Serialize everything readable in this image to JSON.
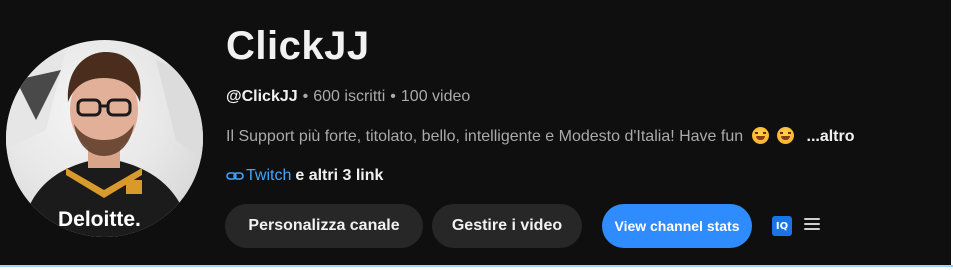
{
  "channel": {
    "name": "ClickJJ",
    "handle": "@ClickJJ",
    "subscribers": "600 iscritti",
    "videos": "100 video",
    "description": "Il Support più forte, titolato, bello, intelligente e Modesto d'Italia! Have fun",
    "more_label": "...altro",
    "avatar_shirt_text": "Deloitte."
  },
  "links": {
    "primary": "Twitch",
    "others": "e altri 3 link"
  },
  "actions": {
    "personalize_label": "Personalizza canale",
    "manage_label": "Gestire i video",
    "stats_label": "View channel stats",
    "iq_label": "IQ"
  },
  "icons": {
    "link": "link-icon",
    "emoji": "laughing-emoji-icon",
    "extension": "iq-extension-icon",
    "menu": "menu-icon"
  },
  "colors": {
    "background": "#0f0f0f",
    "text": "#f1f1f1",
    "muted": "#aaaaaa",
    "link": "#3ea6ff",
    "button": "#272727",
    "stats_button": "#2f8cff"
  }
}
